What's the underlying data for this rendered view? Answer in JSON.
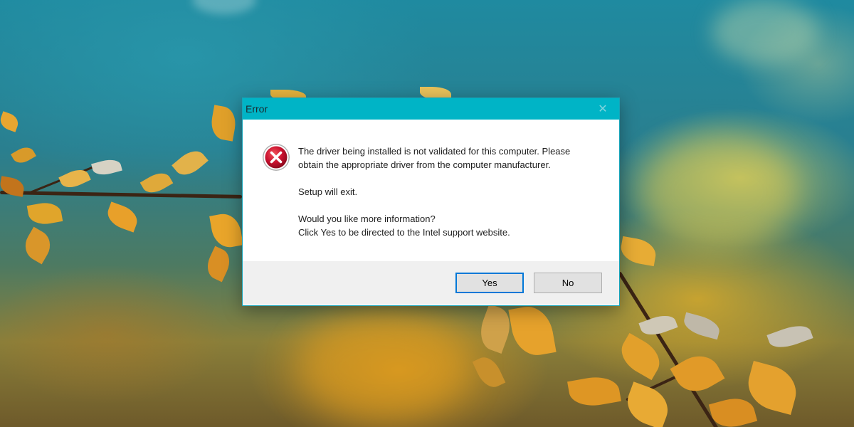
{
  "dialog": {
    "title": "Error",
    "close_glyph": "✕",
    "icon": "error-icon",
    "message_lines": [
      "The driver being installed is not validated for this computer. Please",
      "obtain the appropriate driver from the computer manufacturer.",
      "Setup will exit.",
      "Would you like more information?",
      "Click Yes to be directed to the Intel support website."
    ],
    "buttons": {
      "yes": "Yes",
      "no": "No"
    }
  },
  "colors": {
    "titlebar": "#00b4c6",
    "error_red": "#c8102e",
    "default_button_border": "#0078d7"
  }
}
